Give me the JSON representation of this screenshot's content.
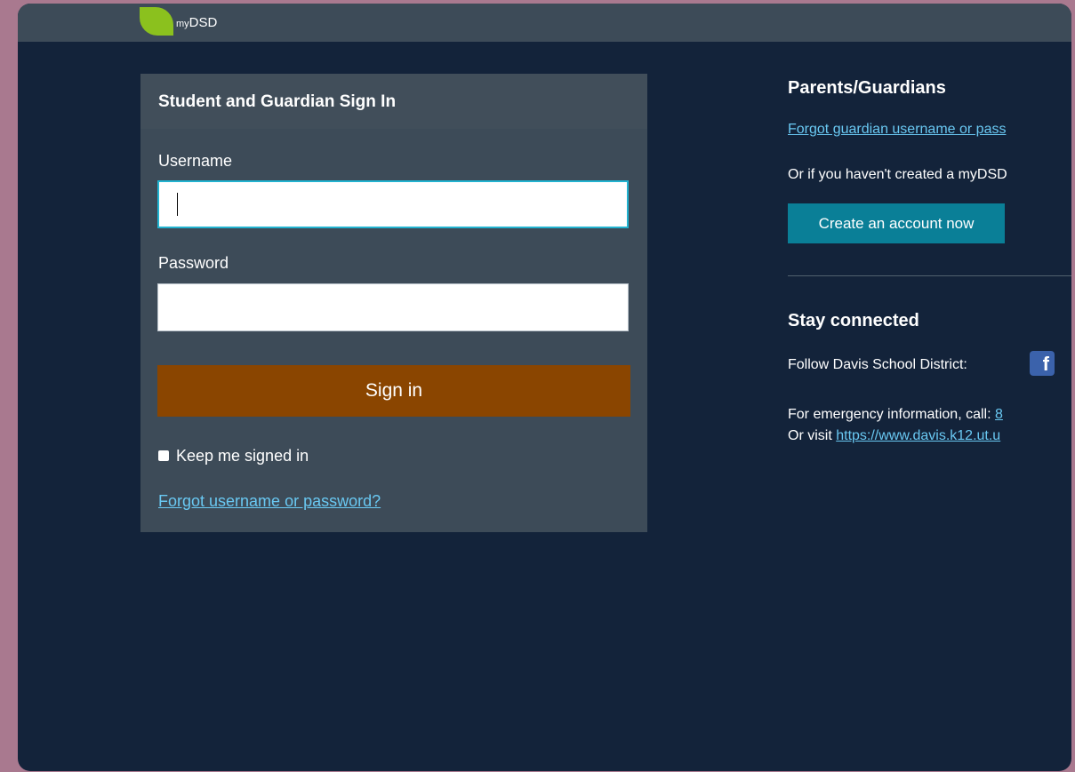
{
  "brand": {
    "prefix": "my",
    "name": "DSD"
  },
  "signin_panel": {
    "title": "Student and Guardian Sign In",
    "username_label": "Username",
    "username_value": "",
    "password_label": "Password",
    "password_value": "",
    "signin_label": "Sign in",
    "keep_signed_in_label": "Keep me signed in",
    "keep_signed_in_checked": false,
    "forgot_link": "Forgot username or password?"
  },
  "parents": {
    "heading": "Parents/Guardians",
    "forgot_link": "Forgot guardian username or pass",
    "no_account_text": "Or if you haven't created a myDSD",
    "create_button": "Create an account now"
  },
  "stay_connected": {
    "heading": "Stay connected",
    "follow_text": "Follow Davis School District:",
    "social_icon": "facebook-icon",
    "emergency_text": "For emergency information, call: ",
    "emergency_phone": "8",
    "visit_text": "Or visit ",
    "visit_link": "https://www.davis.k12.ut.u"
  },
  "colors": {
    "page_bg": "#a9798f",
    "window_bg": "#13233a",
    "panel_bg": "#3d4b58",
    "signin_button": "#8a4500",
    "create_button": "#0a7f97",
    "link": "#69c8f2",
    "logo_leaf": "#8bc11e"
  }
}
